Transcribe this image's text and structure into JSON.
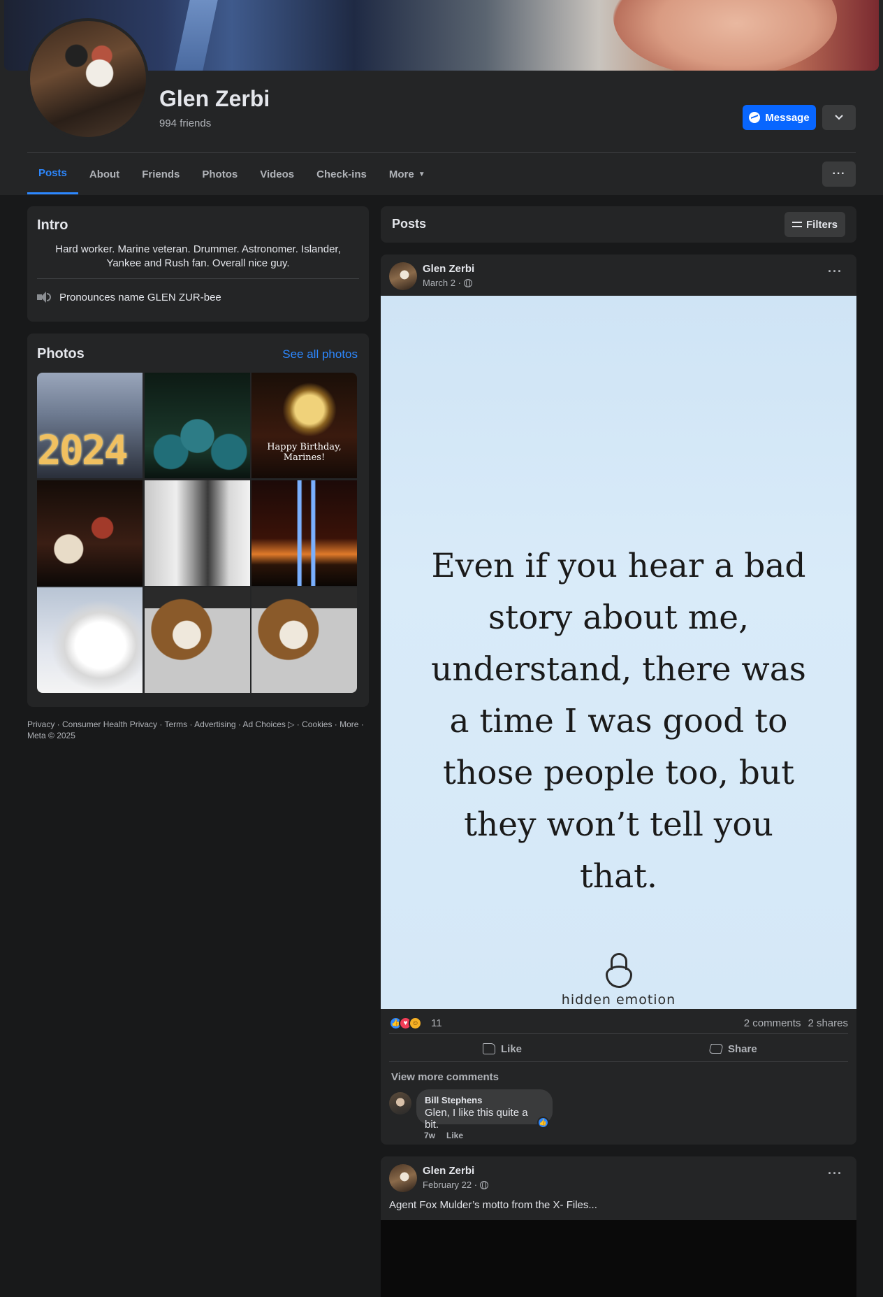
{
  "profile": {
    "name": "Glen Zerbi",
    "friends": "994 friends",
    "message_label": "Message"
  },
  "tabs": [
    {
      "label": "Posts"
    },
    {
      "label": "About"
    },
    {
      "label": "Friends"
    },
    {
      "label": "Photos"
    },
    {
      "label": "Videos"
    },
    {
      "label": "Check-ins"
    },
    {
      "label": "More"
    }
  ],
  "intro": {
    "title": "Intro",
    "bio": "Hard worker. Marine veteran. Drummer. Astronomer. Islander, Yankee and Rush fan. Overall nice guy.",
    "pronunciation": "Pronounces name GLEN ZUR-bee"
  },
  "photos": {
    "title": "Photos",
    "see_all": "See all photos",
    "photo1_text": "2024",
    "photo3_caption": "Happy Birthday, Marines!"
  },
  "footer": "Privacy · Consumer Health Privacy · Terms · Advertising · Ad Choices ▷ · Cookies · More · Meta © 2025",
  "posts_header": {
    "title": "Posts",
    "filters_label": "Filters"
  },
  "post1": {
    "author": "Glen Zerbi",
    "date": "March 2 ·",
    "quote": "Even if you hear a bad story about me, understand, there was a time I was good to those people too, but they won’t tell you that.",
    "brand": "hidden emotion",
    "reaction_count": "11",
    "comments": "2 comments",
    "shares": "2 shares",
    "like_label": "Like",
    "share_label": "Share",
    "view_more": "View more comments",
    "comment": {
      "author": "Bill Stephens",
      "text": "Glen, I like this quite a bit.",
      "time": "7w",
      "like": "Like"
    }
  },
  "post2": {
    "author": "Glen Zerbi",
    "date": "February 22 ·",
    "text": "Agent Fox Mulder’s motto from the X- Files..."
  }
}
